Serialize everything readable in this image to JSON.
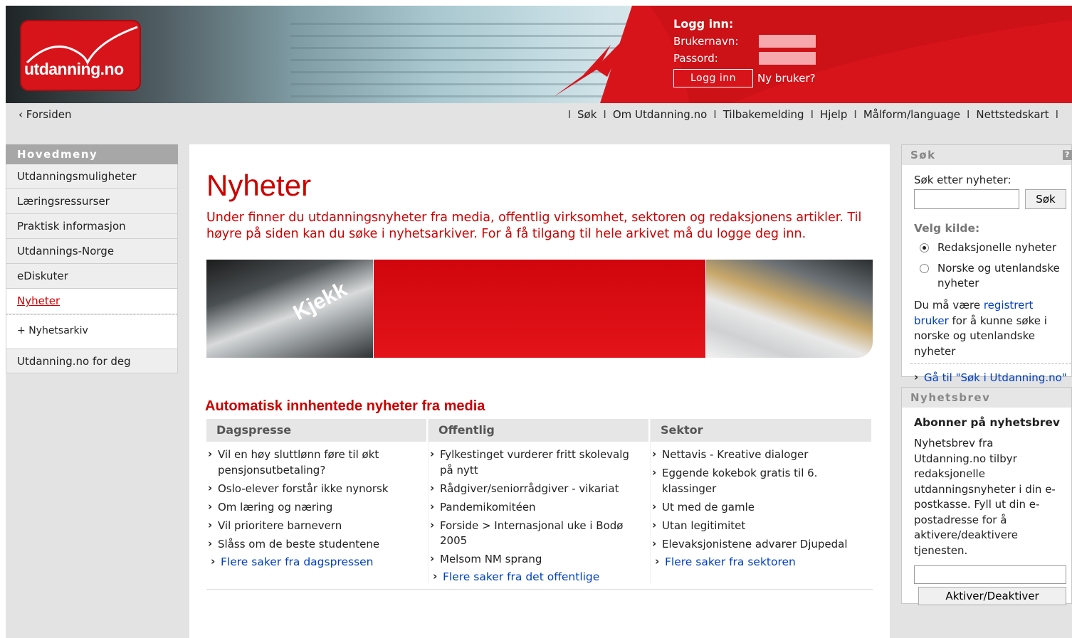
{
  "logo": {
    "text": "utdanning.no"
  },
  "login": {
    "title": "Logg inn:",
    "username_label": "Brukernavn:",
    "password_label": "Passord:",
    "button": "Logg inn",
    "new_user": "Ny bruker?"
  },
  "topnav": {
    "home": "Forsiden",
    "links": [
      "Søk",
      "Om Utdanning.no",
      "Tilbakemelding",
      "Hjelp",
      "Målform/language",
      "Nettstedskart"
    ]
  },
  "menu": {
    "title": "Hovedmeny",
    "items": [
      "Utdanningsmuligheter",
      "Læringsressurser",
      "Praktisk informasjon",
      "Utdannings-Norge",
      "eDiskuter"
    ],
    "active": "Nyheter",
    "sub": "Nyhetsarkiv",
    "last": "Utdanning.no for deg"
  },
  "main": {
    "title": "Nyheter",
    "intro": "Under finner du utdanningsnyheter fra media, offentlig virksomhet, sektoren og redaksjonens artikler. Til høyre på siden kan du søke i nyhetsarkiver. For å få tilgang til hele arkivet må du logge deg inn.",
    "banner_word": "Kjekk",
    "section_title": "Automatisk innhentede nyheter fra media",
    "columns": [
      {
        "head": "Dagspresse",
        "items": [
          "Vil en høy sluttlønn føre til økt pensjonsutbetaling?",
          "Oslo-elever forstår ikke nynorsk",
          "Om læring og næring",
          "Vil prioritere barnevern",
          "Slåss om de beste studentene"
        ],
        "more": "Flere saker fra dagspressen"
      },
      {
        "head": "Offentlig",
        "items": [
          "Fylkestinget vurderer fritt skolevalg på nytt",
          "Rådgiver/seniorrådgiver - vikariat",
          "Pandemikomitéen",
          "Forside > Internasjonal uke i Bodø 2005",
          "Melsom NM sprang"
        ],
        "more": "Flere saker fra det offentlige"
      },
      {
        "head": "Sektor",
        "items": [
          "Nettavis - Kreative dialoger",
          "Eggende kokebok gratis til 6. klassinger",
          "Ut med de gamle",
          "Utan legitimitet",
          "Elevaksjonistene advarer Djupedal"
        ],
        "more": "Flere saker fra sektoren"
      }
    ]
  },
  "search": {
    "title": "Søk",
    "label": "Søk etter nyheter:",
    "button": "Søk",
    "source_label": "Velg kilde:",
    "options": [
      "Redaksjonelle nyheter",
      "Norske og utenlandske nyheter"
    ],
    "selected": "Redaksjonelle nyheter",
    "note_before": "Du må være ",
    "note_link": "registrert bruker",
    "note_after": " for å kunne søke i norske og utenlandske nyheter",
    "goto": "Gå til \"Søk i Utdanning.no\""
  },
  "newsletter": {
    "title": "Nyhetsbrev",
    "subtitle": "Abonner på nyhetsbrev",
    "text": "Nyhetsbrev fra Utdanning.no tilbyr redaksjonelle utdanningsnyheter i din e-postkasse. Fyll ut din e-postadresse for å aktivere/deaktivere tjenesten.",
    "button": "Aktiver/Deaktiver"
  },
  "colors": {
    "brand_red": "#d8141b",
    "text_red": "#cc0000",
    "link_blue": "#0040c0"
  },
  "icons": {
    "help": "help-icon",
    "bullet": "chevron-right-icon"
  }
}
